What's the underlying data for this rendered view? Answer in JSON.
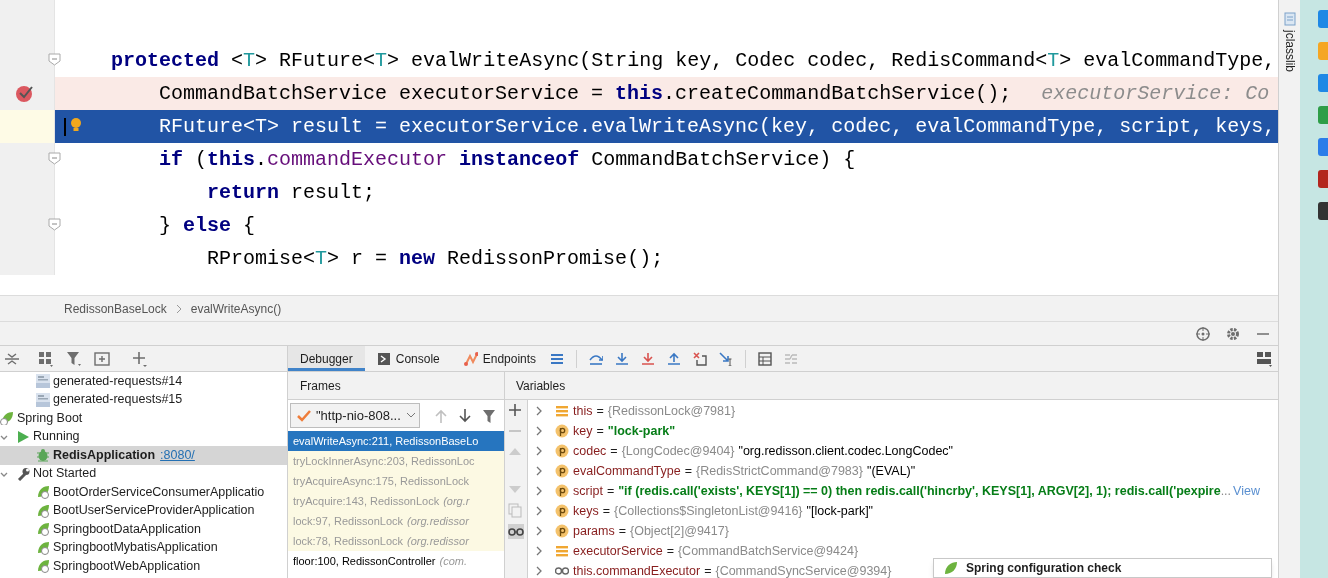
{
  "editor": {
    "lines": [
      {
        "kind": "plain",
        "fold": true,
        "tokens": [
          {
            "kind": "kw",
            "t": "    protected"
          },
          {
            "kind": "pl",
            "t": " <"
          },
          {
            "kind": "tp",
            "t": "T"
          },
          {
            "kind": "pl",
            "t": "> RFuture<"
          },
          {
            "kind": "tp",
            "t": "T"
          },
          {
            "kind": "pl",
            "t": "> evalWriteAsync(String key, Codec codec, RedisCommand<"
          },
          {
            "kind": "tp",
            "t": "T"
          },
          {
            "kind": "pl",
            "t": "> evalCommandType,"
          }
        ]
      },
      {
        "kind": "breakpoint",
        "fold": false,
        "tokens": [
          {
            "kind": "pl",
            "t": "        CommandBatchService executorService = "
          },
          {
            "kind": "kw",
            "t": "this"
          },
          {
            "kind": "pl",
            "t": ".createCommandBatchService();"
          }
        ],
        "hint": "executorService: Co"
      },
      {
        "kind": "execution",
        "fold": false,
        "tokens": [
          {
            "kind": "pl",
            "t": "        RFuture<T> result = executorService.evalWriteAsync(key, codec, evalCommandType, script, keys,"
          }
        ]
      },
      {
        "kind": "plain",
        "fold": true,
        "tokens": [
          {
            "kind": "kw",
            "t": "        if"
          },
          {
            "kind": "pl",
            "t": " ("
          },
          {
            "kind": "kw",
            "t": "this"
          },
          {
            "kind": "pl",
            "t": "."
          },
          {
            "kind": "fd",
            "t": "commandExecutor"
          },
          {
            "kind": "kw",
            "t": " instanceof"
          },
          {
            "kind": "pl",
            "t": " CommandBatchService) {"
          }
        ]
      },
      {
        "kind": "plain",
        "fold": false,
        "tokens": [
          {
            "kind": "kw",
            "t": "            return"
          },
          {
            "kind": "pl",
            "t": " result;"
          }
        ]
      },
      {
        "kind": "plain",
        "fold": true,
        "tokens": [
          {
            "kind": "pl",
            "t": "        } "
          },
          {
            "kind": "kw",
            "t": "else"
          },
          {
            "kind": "pl",
            "t": " {"
          }
        ]
      },
      {
        "kind": "plain",
        "fold": false,
        "tokens": [
          {
            "kind": "pl",
            "t": "            RPromise<"
          },
          {
            "kind": "tp",
            "t": "T"
          },
          {
            "kind": "pl",
            "t": "> r = "
          },
          {
            "kind": "kw",
            "t": "new"
          },
          {
            "kind": "pl",
            "t": " RedissonPromise();"
          }
        ]
      }
    ]
  },
  "breadcrumbs": [
    "RedissonBaseLock",
    "evalWriteAsync()"
  ],
  "side_strip": {
    "label": "jclasslib"
  },
  "services": {
    "tree": [
      {
        "kind": "request",
        "label": "generated-requests#14",
        "selected": false
      },
      {
        "kind": "request",
        "label": "generated-requests#15",
        "selected": false
      },
      {
        "kind": "springboot",
        "label": "Spring Boot",
        "selected": false,
        "children": [
          {
            "kind": "running",
            "label": "Running",
            "selected": false,
            "expanded": true,
            "children": [
              {
                "kind": "app-running",
                "label": "RedisApplication",
                "link": ":8080/",
                "selected": true
              }
            ]
          },
          {
            "kind": "not-started",
            "label": "Not Started",
            "selected": false,
            "expanded": true,
            "children": [
              {
                "kind": "app",
                "label": "BootOrderServiceConsumerApplicatio",
                "selected": false
              },
              {
                "kind": "app",
                "label": "BootUserServiceProviderApplication",
                "selected": false
              },
              {
                "kind": "app",
                "label": "SpringbootDataApplication",
                "selected": false
              },
              {
                "kind": "app",
                "label": "SpringbootMybatisApplication",
                "selected": false
              },
              {
                "kind": "app",
                "label": "SpringbootWebApplication",
                "selected": false
              }
            ]
          }
        ]
      }
    ]
  },
  "debugger": {
    "tabs": [
      {
        "label": "Debugger",
        "selected": true
      },
      {
        "label": "Console",
        "selected": false
      },
      {
        "label": "Endpoints",
        "selected": false
      }
    ],
    "frames_title": "Frames",
    "thread": "\"http-nio-808...",
    "frames": [
      {
        "method": "evalWriteAsync:211, RedissonBaseLo",
        "library": false,
        "selected": true
      },
      {
        "method": "tryLockInnerAsync:203, RedissonLoc",
        "library": true,
        "selected": false
      },
      {
        "method": "tryAcquireAsync:175, RedissonLock",
        "library": true,
        "selected": false
      },
      {
        "method": "tryAcquire:143, RedissonLock",
        "package": "(org.r",
        "library": true,
        "selected": false
      },
      {
        "method": "lock:97, RedissonLock",
        "package": "(org.redissor",
        "library": true,
        "selected": false
      },
      {
        "method": "lock:78, RedissonLock",
        "package": "(org.redissor",
        "library": true,
        "selected": false
      },
      {
        "method": "floor:100, RedissonController",
        "package": "(com.",
        "library": false,
        "selected": false
      }
    ],
    "variables_title": "Variables",
    "variables": [
      {
        "kind": "field",
        "name": "this",
        "operator": "=",
        "type": "{RedissonLock@7981}"
      },
      {
        "kind": "param",
        "name": "key",
        "operator": "=",
        "string": "\"lock-park\""
      },
      {
        "kind": "param",
        "name": "codec",
        "operator": "=",
        "type": "{LongCodec@9404}",
        "value": "\"org.redisson.client.codec.LongCodec\""
      },
      {
        "kind": "param",
        "name": "evalCommandType",
        "operator": "=",
        "type": "{RedisStrictCommand@7983}",
        "value": "\"(EVAL)\""
      },
      {
        "kind": "param",
        "name": "script",
        "operator": "=",
        "string": "\"if (redis.call('exists', KEYS[1]) == 0) then redis.call('hincrby', KEYS[1], ARGV[2], 1); redis.call('pexpire",
        "more": "...",
        "link": "View"
      },
      {
        "kind": "param",
        "name": "keys",
        "operator": "=",
        "type": "{Collections$SingletonList@9416}",
        "value": "\"[lock-park]\""
      },
      {
        "kind": "param",
        "name": "params",
        "operator": "=",
        "type": "{Object[2]@9417}"
      },
      {
        "kind": "field",
        "name": "executorService",
        "operator": "=",
        "type": "{CommandBatchService@9424}"
      },
      {
        "kind": "watch",
        "name": "this.commandExecutor",
        "operator": "=",
        "type": "{CommandSyncService@9394}"
      }
    ]
  },
  "notification": {
    "title": "Spring configuration check"
  }
}
